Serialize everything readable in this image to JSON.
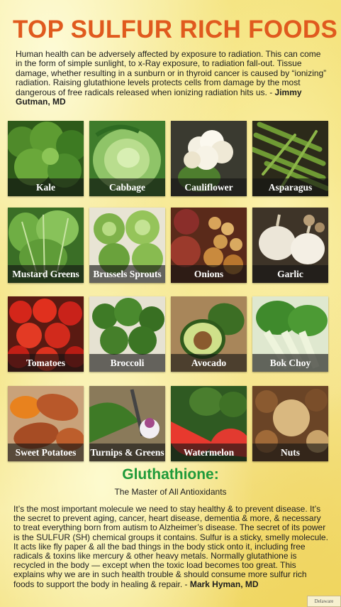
{
  "title": "TOP SULFUR RICH FOODS",
  "intro": {
    "text": "Human health can be adversely affected by exposure to radiation.  This can come in the form of simple sunlight, to x-Ray exposure, to radiation fall-out.  Tissue damage, whether resulting in a sunburn or in thyroid cancer is caused by “ionizing” radiation.  Raising glutathione levels protects cells from damage by the most dangerous of free radicals released when ionizing radiation hits us. - ",
    "author": "Jimmy Gutman, MD"
  },
  "foods": [
    {
      "label": "Kale",
      "icon": "kale-photo"
    },
    {
      "label": "Cabbage",
      "icon": "cabbage-photo"
    },
    {
      "label": "Cauliflower",
      "icon": "cauliflower-photo"
    },
    {
      "label": "Asparagus",
      "icon": "asparagus-photo"
    },
    {
      "label": "Mustard Greens",
      "icon": "mustard-greens-photo"
    },
    {
      "label": "Brussels Sprouts",
      "icon": "brussels-sprouts-photo"
    },
    {
      "label": "Onions",
      "icon": "onions-photo"
    },
    {
      "label": "Garlic",
      "icon": "garlic-photo"
    },
    {
      "label": "Tomatoes",
      "icon": "tomatoes-photo"
    },
    {
      "label": "Broccoli",
      "icon": "broccoli-photo"
    },
    {
      "label": "Avocado",
      "icon": "avocado-photo"
    },
    {
      "label": "Bok Choy",
      "icon": "bok-choy-photo"
    },
    {
      "label": "Sweet Potatoes",
      "icon": "sweet-potatoes-photo"
    },
    {
      "label": "Turnips & Greens",
      "icon": "turnips-greens-photo"
    },
    {
      "label": "Watermelon",
      "icon": "watermelon-photo"
    },
    {
      "label": "Nuts",
      "icon": "nuts-photo"
    }
  ],
  "glutathione": {
    "title": "Gluthathione:",
    "subtitle": "The Master of All Antioxidants",
    "text": "It’s the most important molecule we need to stay healthy & to prevent disease.  It’s the secret to prevent aging, cancer, heart disease, dementia & more, & necessary to treat everything born from autism to Alzheimer’s disease.  The secret of its power is the SULFUR (SH) chemical groups it contains.  Sulfur is a sticky, smelly molecule.  It acts like fly paper & all the bad things in the body stick onto it, including free radicals & toxins like mercury & other heavy metals.  Normally glutathione is recycled in the body — except when the toxic load becomes too great.  This explains why we are in such health trouble & should consume more sulfur rich foods to support the body in healing & repair. - ",
    "author": "Mark Hyman, MD"
  },
  "logo_text": "Delaware",
  "colors": {
    "title": "#e05a1e",
    "glutathione_title": "#1f9a3a",
    "label_bg": "#141414"
  }
}
